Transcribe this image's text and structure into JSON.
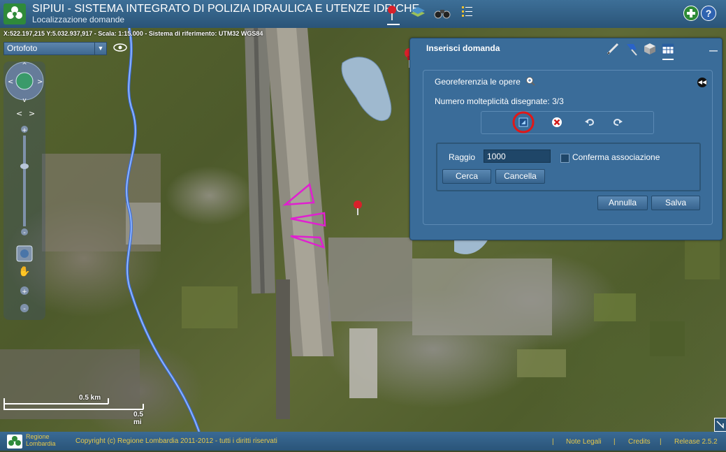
{
  "header": {
    "title": "SIPIUI - SISTEMA INTEGRATO DI POLIZIA IDRAULICA E UTENZE IDRICHE",
    "subtitle": "Localizzazione domande",
    "tools": [
      {
        "icon": "pushpin-icon",
        "selected": true
      },
      {
        "icon": "layers-icon",
        "selected": false
      },
      {
        "icon": "binoculars-icon",
        "selected": false
      },
      {
        "icon": "list-icon",
        "selected": false
      }
    ],
    "right_icons": [
      "add-icon",
      "help-icon"
    ]
  },
  "map": {
    "coords_text": "X:522.197,215 Y:5.032.937,917 - Scala: 1:15.000 - Sistema di riferimento: UTM32 WGS84",
    "layer_select": "Ortofoto",
    "scale_km": "0.5 km",
    "scale_mi": "0.5 mi"
  },
  "panel": {
    "title": "Inserisci domanda",
    "tools": [
      "pencil-icon",
      "pin-icon",
      "box-icon",
      "table-icon"
    ],
    "georef_label": "Georeferenzia le opere",
    "molteplicita": "Numero molteplicità disegnate: 3/3",
    "raggio_label": "Raggio",
    "raggio_value": "1000",
    "conferma_label": "Conferma associazione",
    "cerca": "Cerca",
    "cancella": "Cancella",
    "annulla": "Annulla",
    "salva": "Salva"
  },
  "footer": {
    "logo_line1": "Regione",
    "logo_line2": "Lombardia",
    "copyright": "Copyright (c) Regione Lombardia 2011-2012 - tutti i diritti riservati",
    "note_legali": "Note Legali",
    "credits": "Credits",
    "release": "Release 2.5.2"
  }
}
